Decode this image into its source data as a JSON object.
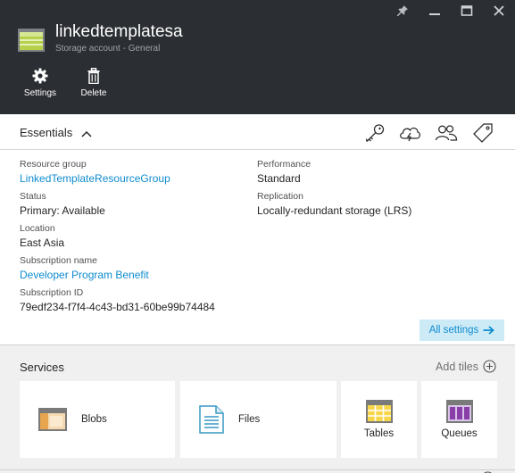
{
  "blade": {
    "title": "linkedtemplatesa",
    "subtitle": "Storage account - General",
    "icon": "storage-account-icon",
    "window_controls": [
      "pin-icon",
      "minimize-icon",
      "maximize-icon",
      "close-icon"
    ]
  },
  "commands": [
    {
      "label": "Settings",
      "icon": "gear-icon"
    },
    {
      "label": "Delete",
      "icon": "trash-icon"
    }
  ],
  "essentials": {
    "title": "Essentials",
    "toolbar_icons": [
      "key-icon",
      "cloud-lightning-icon",
      "users-icon",
      "tag-icon"
    ],
    "left": [
      {
        "label": "Resource group",
        "value": "LinkedTemplateResourceGroup",
        "link": true
      },
      {
        "label": "Status",
        "value": "Primary: Available",
        "link": false
      },
      {
        "label": "Location",
        "value": "East Asia",
        "link": false
      },
      {
        "label": "Subscription name",
        "value": "Developer Program Benefit",
        "link": true
      },
      {
        "label": "Subscription ID",
        "value": "79edf234-f7f4-4c43-bd31-60be99b74484",
        "link": false
      }
    ],
    "right": [
      {
        "label": "Performance",
        "value": "Standard",
        "link": false
      },
      {
        "label": "Replication",
        "value": "Locally-redundant storage (LRS)",
        "link": false
      }
    ],
    "all_settings_label": "All settings"
  },
  "services": {
    "title": "Services",
    "add_tiles_label": "Add tiles",
    "tiles": [
      {
        "label": "Blobs",
        "icon": "blobs-icon"
      },
      {
        "label": "Files",
        "icon": "files-icon"
      },
      {
        "label": "Tables",
        "icon": "tables-icon"
      },
      {
        "label": "Queues",
        "icon": "queues-icon"
      }
    ]
  },
  "colors": {
    "header_bg": "#2b2e33",
    "link": "#0f8cd0",
    "all_settings_bg": "#cdeaf7",
    "services_bg": "#f0f0f0"
  }
}
